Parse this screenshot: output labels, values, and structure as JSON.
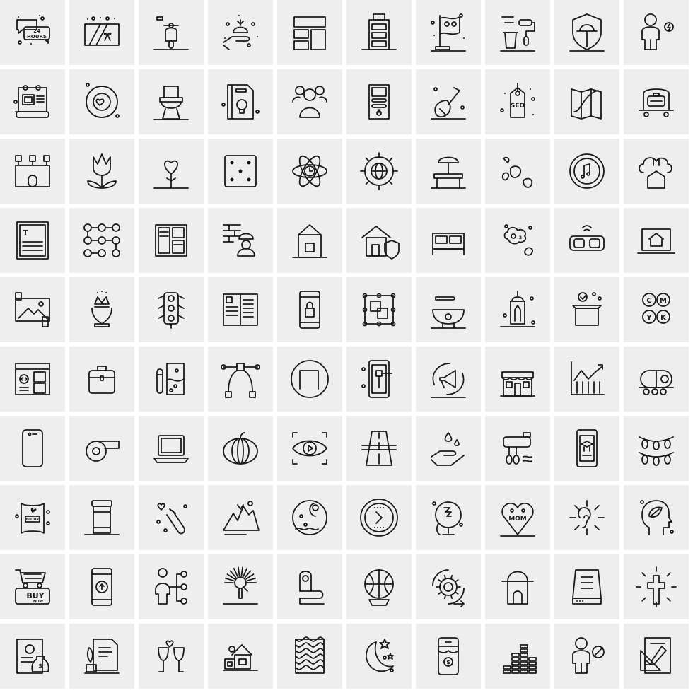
{
  "grid": {
    "rows": 10,
    "columns": 10,
    "background": "#ffffff",
    "tile_color": "#eeeeee",
    "stroke_color": "#1a1a1a"
  },
  "icons": [
    {
      "name": "24-hours-chat-icon",
      "text": "24|HOURS"
    },
    {
      "name": "gift-card-icon"
    },
    {
      "name": "scooter-icon"
    },
    {
      "name": "hand-money-bag-icon"
    },
    {
      "name": "layout-grid-icon"
    },
    {
      "name": "battery-icon"
    },
    {
      "name": "pirate-flag-icon"
    },
    {
      "name": "paint-roller-bucket-icon"
    },
    {
      "name": "shield-sunset-icon"
    },
    {
      "name": "user-power-icon"
    },
    {
      "name": "blueprint-calendar-icon"
    },
    {
      "name": "love-clock-icon"
    },
    {
      "name": "toilet-icon"
    },
    {
      "name": "idea-book-icon"
    },
    {
      "name": "user-group-icon"
    },
    {
      "name": "server-power-icon"
    },
    {
      "name": "guitar-icon"
    },
    {
      "name": "seo-tag-icon",
      "text": "SEO"
    },
    {
      "name": "map-icon"
    },
    {
      "name": "luggage-cart-icon"
    },
    {
      "name": "castle-icon"
    },
    {
      "name": "tulip-icon"
    },
    {
      "name": "heart-lollipop-icon"
    },
    {
      "name": "dice-icon"
    },
    {
      "name": "atom-clock-icon"
    },
    {
      "name": "gear-globe-icon"
    },
    {
      "name": "beach-table-icon"
    },
    {
      "name": "meat-drumsticks-icon"
    },
    {
      "name": "music-disc-icon"
    },
    {
      "name": "cloud-house-icon"
    },
    {
      "name": "text-document-icon",
      "text": "T"
    },
    {
      "name": "pattern-lock-icon"
    },
    {
      "name": "newspaper-layout-icon"
    },
    {
      "name": "builder-wall-icon"
    },
    {
      "name": "milk-carton-icon"
    },
    {
      "name": "house-shield-icon"
    },
    {
      "name": "bed-icon"
    },
    {
      "name": "co2-pollution-icon"
    },
    {
      "name": "vr-glasses-icon"
    },
    {
      "name": "laptop-home-icon"
    },
    {
      "name": "picture-frame-icon"
    },
    {
      "name": "crown-hands-icon"
    },
    {
      "name": "traffic-light-icon"
    },
    {
      "name": "open-book-icon"
    },
    {
      "name": "mobile-lock-icon"
    },
    {
      "name": "design-layers-icon"
    },
    {
      "name": "bowl-spoon-icon"
    },
    {
      "name": "lantern-icon"
    },
    {
      "name": "box-check-icon"
    },
    {
      "name": "cmyk-icon",
      "text": "C|M|Y|K"
    },
    {
      "name": "web-code-icon"
    },
    {
      "name": "briefcase-icon"
    },
    {
      "name": "lab-beaker-icon"
    },
    {
      "name": "bezier-curve-icon"
    },
    {
      "name": "circle-square-wave-icon"
    },
    {
      "name": "mobile-auction-icon"
    },
    {
      "name": "megaphone-cycle-icon"
    },
    {
      "name": "shop-store-icon"
    },
    {
      "name": "growth-chart-icon"
    },
    {
      "name": "tank-wagon-icon"
    },
    {
      "name": "smartphone-icon"
    },
    {
      "name": "whistle-icon"
    },
    {
      "name": "laptop-icon"
    },
    {
      "name": "pumpkin-icon"
    },
    {
      "name": "eye-video-icon"
    },
    {
      "name": "road-icon"
    },
    {
      "name": "hand-water-drop-icon"
    },
    {
      "name": "hand-mixer-icon"
    },
    {
      "name": "mobile-education-icon"
    },
    {
      "name": "party-lights-icon"
    },
    {
      "name": "flour-sack-icon",
      "text": "FLOUR"
    },
    {
      "name": "jar-icon"
    },
    {
      "name": "love-potion-icon"
    },
    {
      "name": "volcano-landscape-icon"
    },
    {
      "name": "moon-night-icon"
    },
    {
      "name": "next-arrow-circle-icon"
    },
    {
      "name": "globe-mirror-icon"
    },
    {
      "name": "mom-heart-icon",
      "text": "MOM"
    },
    {
      "name": "ear-listen-icon"
    },
    {
      "name": "head-leaf-icon"
    },
    {
      "name": "buy-now-cart-icon",
      "text": "BUY|NOW"
    },
    {
      "name": "mobile-upload-icon"
    },
    {
      "name": "user-connections-icon"
    },
    {
      "name": "fountain-pen-icon"
    },
    {
      "name": "measuring-tape-icon"
    },
    {
      "name": "basketball-icon"
    },
    {
      "name": "gear-cycle-icon"
    },
    {
      "name": "mosque-door-icon"
    },
    {
      "name": "server-rack-icon"
    },
    {
      "name": "cross-light-icon"
    },
    {
      "name": "certificate-money-icon"
    },
    {
      "name": "contract-quill-icon"
    },
    {
      "name": "wine-glasses-icon"
    },
    {
      "name": "house-icon"
    },
    {
      "name": "fabric-pattern-icon"
    },
    {
      "name": "moon-stars-icon"
    },
    {
      "name": "shop-mobile-payment-icon"
    },
    {
      "name": "bar-levels-icon"
    },
    {
      "name": "user-block-icon"
    },
    {
      "name": "drafting-tools-icon"
    }
  ]
}
